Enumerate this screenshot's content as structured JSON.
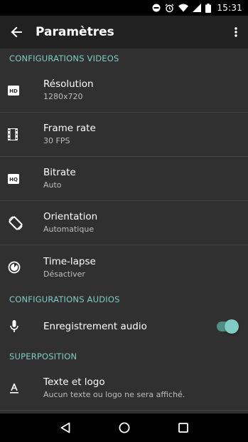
{
  "status_bar": {
    "time": "15:31",
    "icons": [
      "dnd-icon",
      "alarm-icon",
      "wifi-icon",
      "signal-icon",
      "battery-icon"
    ]
  },
  "app_bar": {
    "title": "Paramètres",
    "back_icon": "arrow-back-icon",
    "overflow_icon": "more-vert-icon"
  },
  "sections": {
    "video": {
      "header": "CONFIGURATIONS VIDEOS",
      "items": [
        {
          "title": "Résolution",
          "summary": "1280x720",
          "icon": "hd-icon"
        },
        {
          "title": "Frame rate",
          "summary": "30 FPS",
          "icon": "film-icon"
        },
        {
          "title": "Bitrate",
          "summary": "Auto",
          "icon": "hq-icon"
        },
        {
          "title": "Orientation",
          "summary": "Automatique",
          "icon": "screen-rotation-icon"
        },
        {
          "title": "Time-lapse",
          "summary": "Désactiver",
          "icon": "timelapse-icon"
        }
      ]
    },
    "audio": {
      "header": "CONFIGURATIONS AUDIOS",
      "items": [
        {
          "title": "Enregistrement audio",
          "icon": "mic-icon",
          "toggle_on": true
        }
      ]
    },
    "overlay": {
      "header": "SUPERPOSITION",
      "items": [
        {
          "title": "Texte et logo",
          "summary": "Aucun texte ou logo ne sera affiché.",
          "icon": "text-format-icon"
        }
      ]
    }
  },
  "colors": {
    "accent": "#80CBC4",
    "background": "#303030",
    "app_bar": "#212121"
  },
  "nav_bar": {
    "icons": [
      "back-triangle-icon",
      "home-circle-icon",
      "recents-square-icon"
    ]
  }
}
